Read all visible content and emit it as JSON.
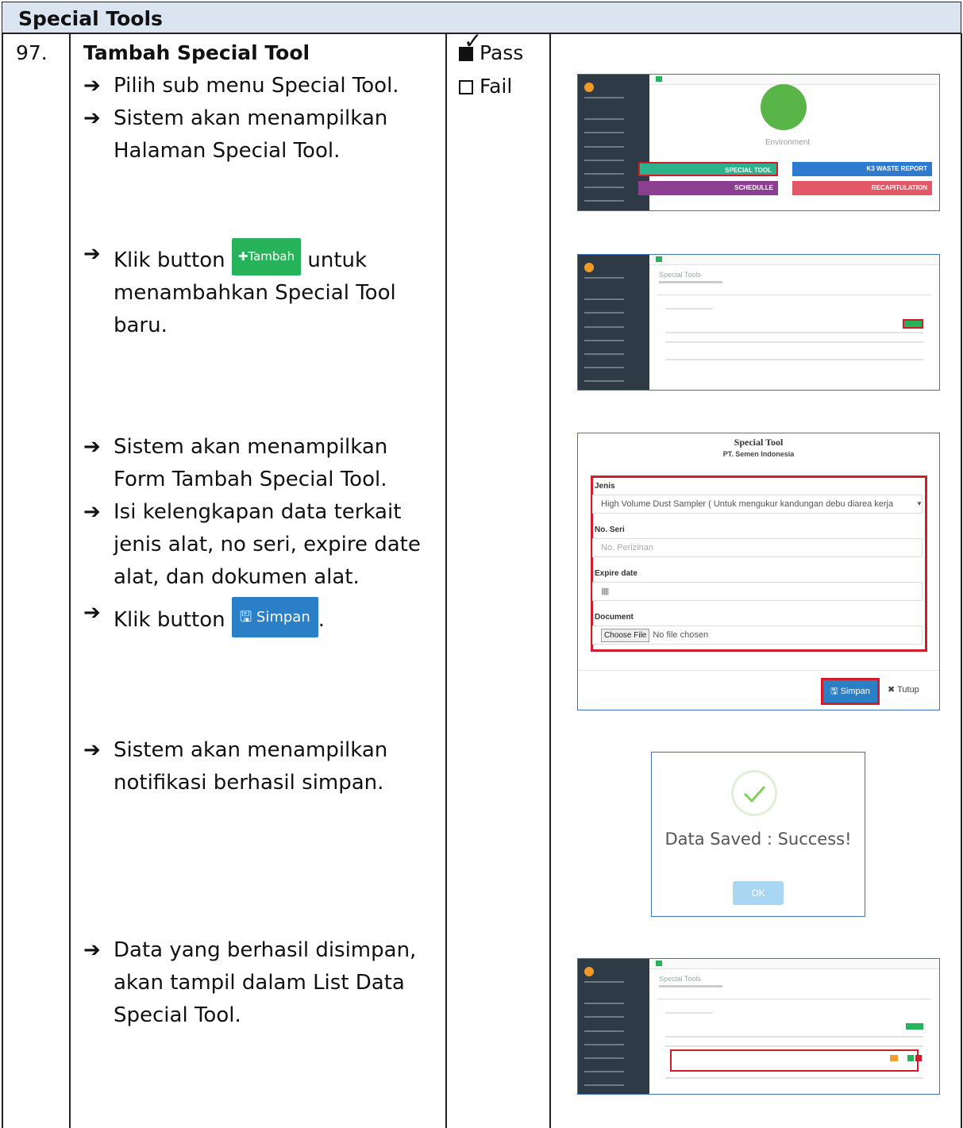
{
  "section_title": "Special Tools",
  "test_number": "97.",
  "test_title": "Tambah Special Tool",
  "steps": [
    {
      "arrow": "➔",
      "lines": [
        "Pilih sub menu Special Tool."
      ]
    },
    {
      "arrow": "➔",
      "lines": [
        "Sistem akan menampilkan",
        "Halaman Special Tool."
      ]
    },
    {
      "arrow": "➔",
      "before": "Klik button",
      "button": "Tambah",
      "after": "untuk",
      "lines": [
        "menambahkan Special Tool",
        "baru."
      ]
    },
    {
      "arrow": "➔",
      "lines": [
        "Sistem akan menampilkan",
        "Form Tambah Special Tool."
      ]
    },
    {
      "arrow": "➔",
      "lines": [
        "Isi kelengkapan data terkait",
        "jenis alat, no seri, expire date",
        "alat, dan dokumen alat."
      ]
    },
    {
      "arrow": "➔",
      "before": "Klik button",
      "button": "Simpan",
      "after": "."
    },
    {
      "arrow": "➔",
      "lines": [
        "Sistem akan menampilkan",
        "notifikasi berhasil simpan."
      ]
    },
    {
      "arrow": "➔",
      "lines": [
        "Data yang berhasil disimpan,",
        "akan tampil dalam List Data",
        "Special Tool."
      ]
    }
  ],
  "result": {
    "pass_label": "Pass",
    "fail_label": "Fail",
    "pass_checked": true
  },
  "shot1": {
    "env_label": "Environment",
    "tiles": [
      {
        "label": "SPECIAL TOOL",
        "color": "#2db38a"
      },
      {
        "label": "K3 WASTE REPORT",
        "color": "#2f7ad1"
      },
      {
        "label": "SCHEDULLE",
        "color": "#8a3f8f"
      },
      {
        "label": "RECAPITULATION",
        "color": "#e25866"
      }
    ]
  },
  "shot2": {
    "title": "Special Tools"
  },
  "form": {
    "title": "Special Tool",
    "subtitle": "PT. Semen Indonesia",
    "jenis_label": "Jenis",
    "jenis_value": "High Volume Dust Sampler ( Untuk mengukur kandungan debu diarea kerja",
    "seri_label": "No. Seri",
    "seri_placeholder": "No. Perizinan",
    "expire_label": "Expire date",
    "doc_label": "Document",
    "choose_file": "Choose File",
    "no_file": "No file chosen",
    "save_button": "Simpan",
    "close_button": "Tutup"
  },
  "success": {
    "message": "Data Saved : Success!",
    "ok": "OK"
  },
  "shot5": {
    "title": "Special Tools"
  }
}
